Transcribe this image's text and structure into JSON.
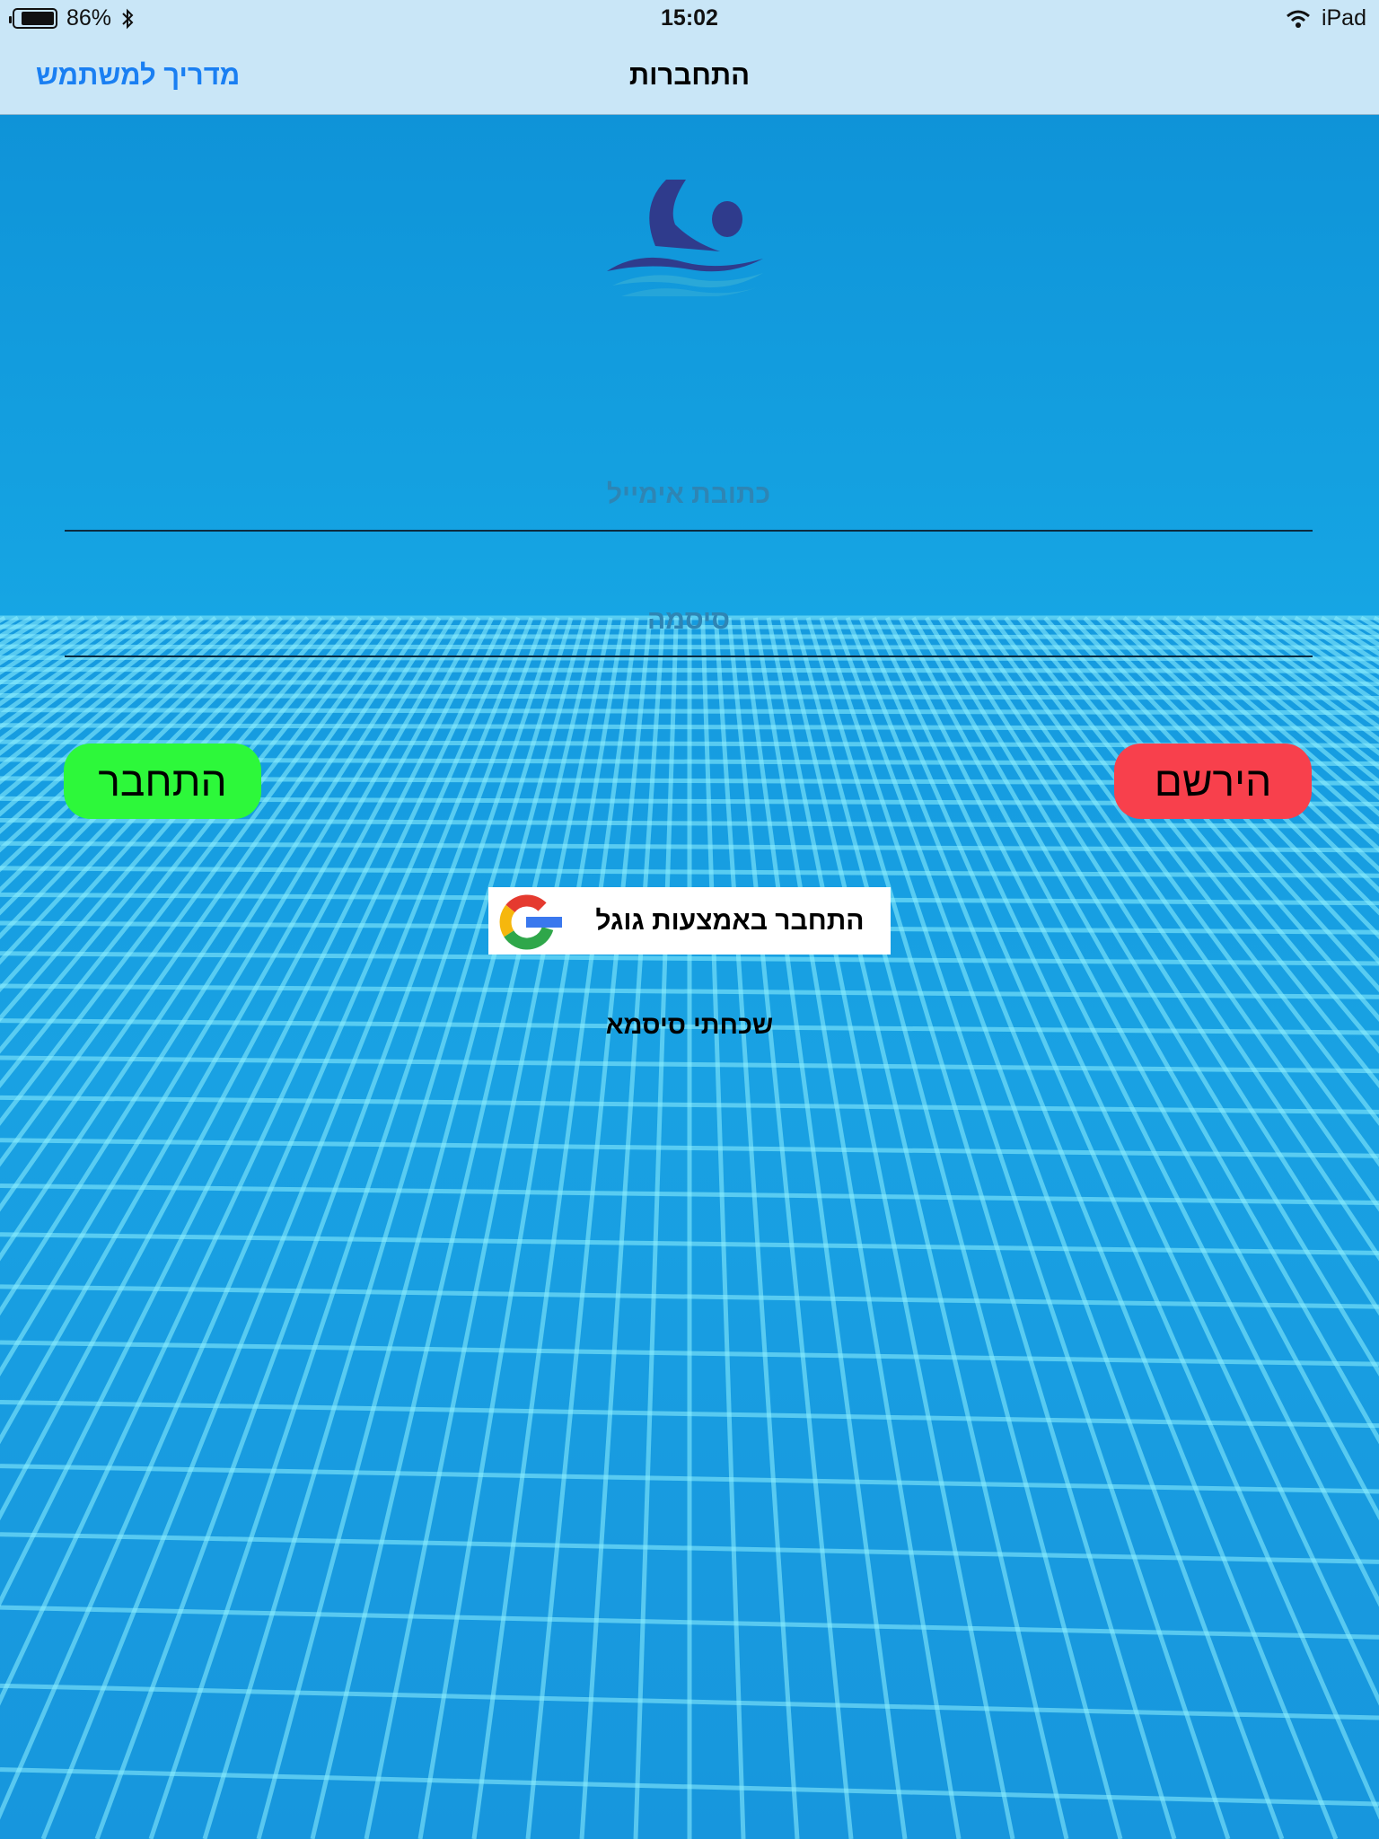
{
  "status_bar": {
    "battery": "86%",
    "time": "15:02",
    "device": "iPad",
    "icons": [
      "battery-icon",
      "bluetooth-icon",
      "wifi-icon"
    ]
  },
  "nav": {
    "title": "התחברות",
    "left_button": "מדריך למשתמש"
  },
  "form": {
    "email_placeholder": "כתובת אימייל",
    "email_value": "",
    "password_placeholder": "סיסמה",
    "password_value": ""
  },
  "buttons": {
    "login": "התחבר",
    "register": "הירשם",
    "google": "התחבר באמצעות גוגל",
    "forgot": "שכחתי סיסמא"
  },
  "colors": {
    "nav_bg": "#c9e6f7",
    "link": "#1a7ff2",
    "login_bg": "#2df83a",
    "register_bg": "#f8404c",
    "pool": "#16a6e4"
  }
}
